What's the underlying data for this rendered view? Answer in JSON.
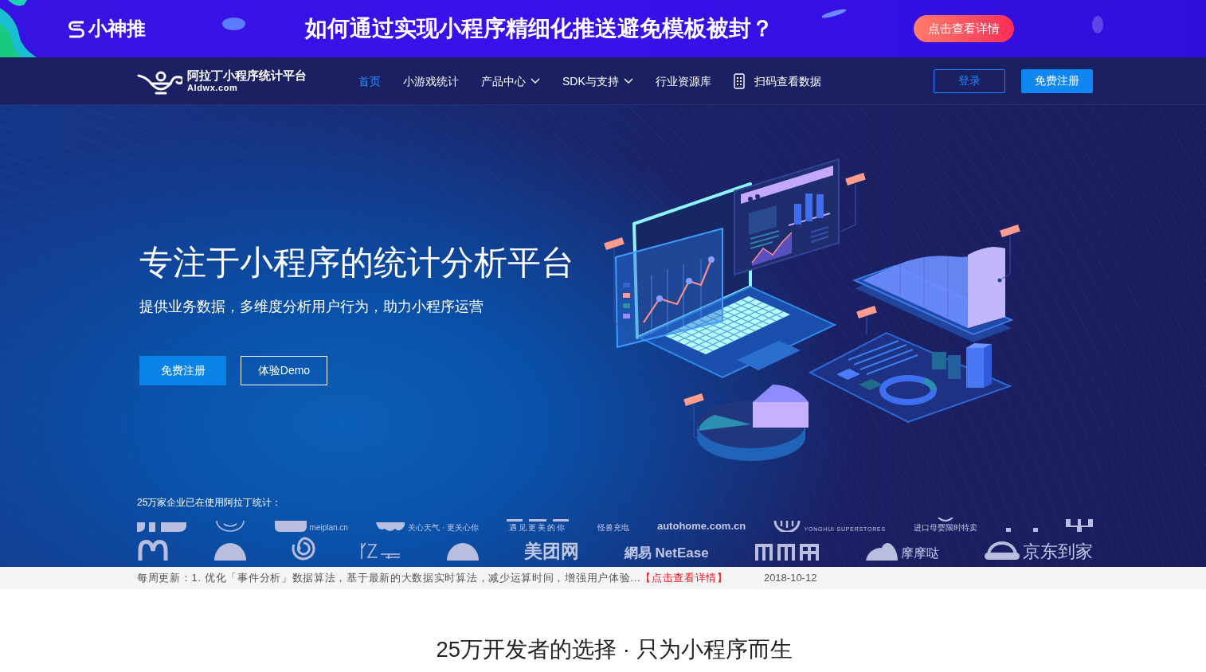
{
  "promo_banner": {
    "brand": "小神推",
    "headline": "如何通过实现小程序精细化推送避免模板被封？",
    "button": "点击查看详情"
  },
  "nav": {
    "logo_title": "阿拉丁小程序统计平台",
    "logo_subtitle": "Aldwx.com",
    "items": [
      {
        "label": "首页",
        "kind": "link",
        "selected": true,
        "dropdown": false
      },
      {
        "label": "小游戏统计",
        "kind": "link",
        "selected": false,
        "dropdown": false
      },
      {
        "label": "产品中心",
        "kind": "link",
        "selected": false,
        "dropdown": true
      },
      {
        "label": "SDK与支持",
        "kind": "link",
        "selected": false,
        "dropdown": true
      },
      {
        "label": "行业资源库",
        "kind": "link",
        "selected": false,
        "dropdown": false
      },
      {
        "label": "扫码查看数据",
        "kind": "qr",
        "selected": false,
        "dropdown": false
      }
    ],
    "buttons": [
      {
        "label": "登录",
        "kind": "outline"
      },
      {
        "label": "免费注册",
        "kind": "filled"
      }
    ]
  },
  "hero": {
    "title": "专注于小程序的统计分析平台",
    "subtitle": "提供业务数据，多维度分析用户行为，助力小程序运营",
    "buttons": [
      {
        "label": "免费注册",
        "kind": "filled"
      },
      {
        "label": "体验Demo",
        "kind": "outline"
      }
    ],
    "clients_label": "25万家企业已在使用阿拉丁统计：",
    "client_logo_rows": [
      {
        "logos": [
          {
            "kind": "block"
          },
          {
            "kind": "ring"
          },
          {
            "kind": "tile",
            "text": "meiplan.cn"
          },
          {
            "kind": "wave",
            "text": "关心天气 · 更关心你"
          },
          {
            "kind": "bar",
            "text": "遇见更美的你"
          },
          {
            "kind": "small-wordmark",
            "text": "怪兽充电"
          },
          {
            "kind": "web-wordmark",
            "text": "autohome.com.cn"
          },
          {
            "kind": "circle",
            "text": "YONGHUI SUPERSTORES"
          },
          {
            "kind": "smile",
            "text": "进口母婴限时特卖"
          },
          {
            "kind": "dots"
          },
          {
            "kind": "cutblock"
          }
        ]
      },
      {
        "logos": [
          {
            "kind": "arches"
          },
          {
            "kind": "dome"
          },
          {
            "kind": "spiral"
          },
          {
            "kind": "script"
          },
          {
            "kind": "dome"
          },
          {
            "kind": "large-wordmark",
            "text": "美团网"
          },
          {
            "kind": "medium-wordmark",
            "text": "網易 NetEase"
          },
          {
            "kind": "pillars"
          },
          {
            "kind": "mouse",
            "text": "摩摩哒"
          },
          {
            "kind": "car",
            "text": "京东到家"
          }
        ]
      }
    ]
  },
  "news_ticker": {
    "text": "每周更新：1. 优化「事件分析」数据算法，基于最新的大数据实时算法，减少运算时间，增强用户体验...",
    "link": "【点击查看详情】",
    "date": "2018-10-12"
  },
  "section": {
    "title": "25万开发者的选择 · 只为小程序而生"
  }
}
